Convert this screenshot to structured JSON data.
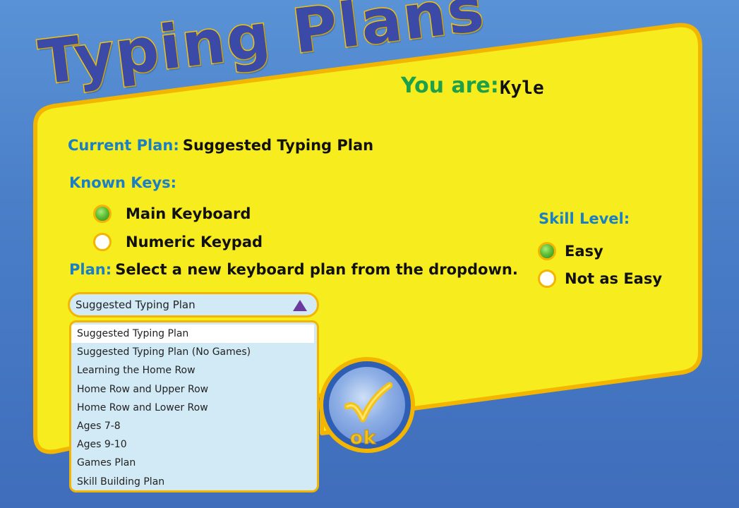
{
  "title": "Typing Plans",
  "you_are": {
    "label": "You are:",
    "name": "Kyle"
  },
  "current_plan": {
    "label": "Current Plan:",
    "value": "Suggested Typing Plan"
  },
  "known_keys": {
    "label": "Known Keys:",
    "options": [
      {
        "label": "Main Keyboard",
        "checked": true
      },
      {
        "label": "Numeric Keypad",
        "checked": false
      }
    ]
  },
  "skill_level": {
    "label": "Skill Level:",
    "options": [
      {
        "label": "Easy",
        "checked": true
      },
      {
        "label": "Not as Easy",
        "checked": false
      }
    ]
  },
  "plan": {
    "label": "Plan:",
    "instruction": "Select a new keyboard plan from the dropdown.",
    "selected": "Suggested Typing Plan",
    "options": [
      "Suggested Typing Plan",
      "Suggested Typing Plan (No Games)",
      "Learning the Home Row",
      "Home Row and Upper Row",
      "Home Row and Lower Row",
      "Ages 7-8",
      "Ages 9-10",
      "Games Plan",
      "Skill Building Plan"
    ]
  },
  "ok_button": {
    "label": "ok",
    "icon": "checkmark-icon"
  },
  "colors": {
    "panel": "#f7ec1e",
    "panel_border": "#f3b500",
    "background": "#4a7fc8",
    "label_blue": "#1b7fc4",
    "you_are_green": "#1ea04a",
    "title_blue": "#3a4aa6"
  }
}
